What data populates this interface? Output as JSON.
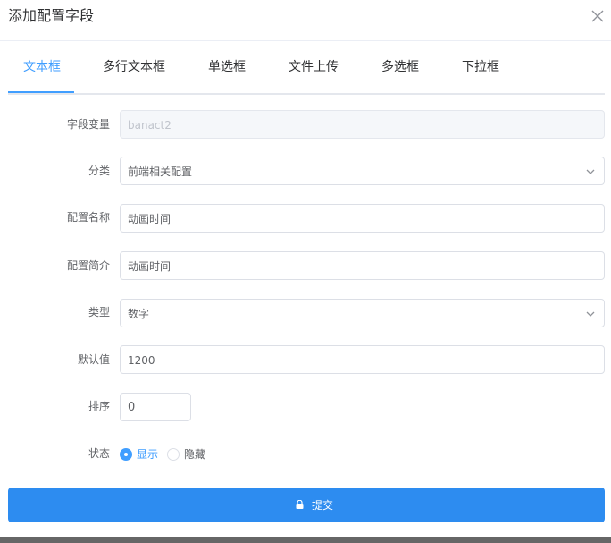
{
  "dialog": {
    "title": "添加配置字段",
    "close_icon": "close-icon"
  },
  "tabs": [
    {
      "label": "文本框",
      "active": true
    },
    {
      "label": "多行文本框",
      "active": false
    },
    {
      "label": "单选框",
      "active": false
    },
    {
      "label": "文件上传",
      "active": false
    },
    {
      "label": "多选框",
      "active": false
    },
    {
      "label": "下拉框",
      "active": false
    }
  ],
  "form": {
    "field_var": {
      "label": "字段变量",
      "value": "banact2"
    },
    "category": {
      "label": "分类",
      "value": "前端相关配置"
    },
    "config_name": {
      "label": "配置名称",
      "value": "动画时间"
    },
    "config_desc": {
      "label": "配置简介",
      "value": "动画时间"
    },
    "type": {
      "label": "类型",
      "value": "数字"
    },
    "default_value": {
      "label": "默认值",
      "value": "1200"
    },
    "sort": {
      "label": "排序",
      "value": "0"
    },
    "status": {
      "label": "状态",
      "options": [
        {
          "label": "显示",
          "checked": true
        },
        {
          "label": "隐藏",
          "checked": false
        }
      ]
    }
  },
  "submit": {
    "label": "提交",
    "icon": "lock-icon"
  },
  "colors": {
    "accent": "#409eff",
    "button": "#2d8cf0"
  }
}
